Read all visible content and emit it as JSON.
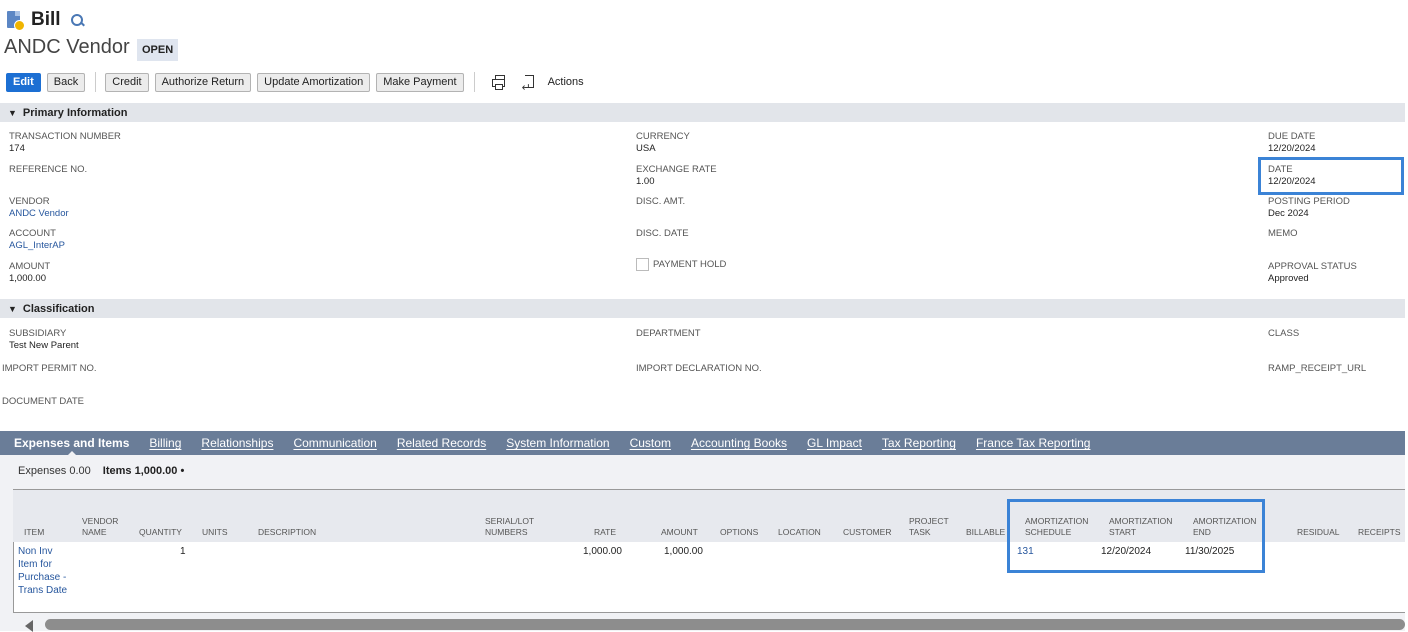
{
  "header": {
    "record_type": "Bill",
    "vendor_name": "ANDC Vendor",
    "status": "OPEN"
  },
  "toolbar": {
    "edit": "Edit",
    "back": "Back",
    "credit": "Credit",
    "authorize_return": "Authorize Return",
    "update_amortization": "Update Amortization",
    "make_payment": "Make Payment",
    "actions": "Actions"
  },
  "primary": {
    "title": "Primary Information",
    "transaction_number_label": "TRANSACTION NUMBER",
    "transaction_number": "174",
    "reference_no_label": "REFERENCE NO.",
    "vendor_label": "VENDOR",
    "vendor": "ANDC Vendor",
    "account_label": "ACCOUNT",
    "account": "AGL_InterAP",
    "amount_label": "AMOUNT",
    "amount": "1,000.00",
    "currency_label": "CURRENCY",
    "currency": "USA",
    "exchange_rate_label": "EXCHANGE RATE",
    "exchange_rate": "1.00",
    "disc_amt_label": "DISC. AMT.",
    "disc_date_label": "DISC. DATE",
    "payment_hold_label": "PAYMENT HOLD",
    "due_date_label": "DUE DATE",
    "due_date": "12/20/2024",
    "date_label": "DATE",
    "date": "12/20/2024",
    "posting_period_label": "POSTING PERIOD",
    "posting_period": "Dec 2024",
    "memo_label": "MEMO",
    "approval_status_label": "APPROVAL STATUS",
    "approval_status": "Approved"
  },
  "classification": {
    "title": "Classification",
    "subsidiary_label": "SUBSIDIARY",
    "subsidiary": "Test New Parent",
    "import_permit_label": "IMPORT PERMIT NO.",
    "document_date_label": "DOCUMENT DATE",
    "department_label": "DEPARTMENT",
    "import_declaration_label": "IMPORT DECLARATION NO.",
    "class_label": "CLASS",
    "ramp_receipt_label": "RAMP_RECEIPT_URL"
  },
  "tabs": [
    "Expenses and Items",
    "Billing",
    "Relationships",
    "Communication",
    "Related Records",
    "System Information",
    "Custom",
    "Accounting Books",
    "GL Impact",
    "Tax Reporting",
    "France Tax Reporting"
  ],
  "subtabs": {
    "expenses": "Expenses 0.00",
    "items": "Items 1,000.00",
    "dot": "•"
  },
  "table": {
    "headers": {
      "item": "ITEM",
      "vendor_name": "VENDOR NAME",
      "quantity": "QUANTITY",
      "units": "UNITS",
      "description": "DESCRIPTION",
      "serial_lot": "SERIAL/LOT NUMBERS",
      "rate": "RATE",
      "amount": "AMOUNT",
      "options": "OPTIONS",
      "location": "LOCATION",
      "customer": "CUSTOMER",
      "project_task": "PROJECT TASK",
      "billable": "BILLABLE",
      "amort_schedule": "AMORTIZATION SCHEDULE",
      "amort_start": "AMORTIZATION START",
      "amort_end": "AMORTIZATION END",
      "residual": "RESIDUAL",
      "receipts": "RECEIPTS"
    },
    "row": {
      "item": "Non Inv Item for Purchase - Trans Date",
      "quantity": "1",
      "rate": "1,000.00",
      "amount": "1,000.00",
      "amort_schedule": "131",
      "amort_start": "12/20/2024",
      "amort_end": "11/30/2025"
    }
  },
  "colors": {
    "accent": "#1c6fd3",
    "tab_bar": "#6a7d98",
    "highlight": "#3b83d6",
    "link": "#27579e"
  }
}
